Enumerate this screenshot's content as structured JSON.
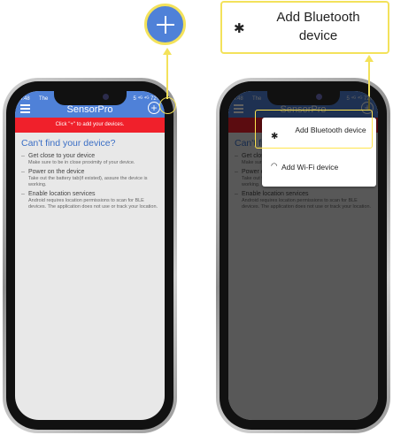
{
  "status": {
    "time": "4:48",
    "carrier": "The",
    "signal": "5 ⁴ᴳ ⁴ᴳ 72%"
  },
  "app": {
    "title": "SensorPro",
    "add_symbol": "+"
  },
  "banner": "Click \"+\" to add your devices.",
  "help": {
    "heading": "Can't find your device?",
    "tips": [
      {
        "title": "Get close to your device",
        "detail": "Make sure to be in close proximity of your device."
      },
      {
        "title": "Power on the device",
        "detail": "Take out the battery tab(if existed), assure the device is working."
      },
      {
        "title": "Enable location services",
        "detail": "Android requires location permissions to scan for BLE devices. The application does not use or track your location."
      }
    ]
  },
  "menu": {
    "items": [
      {
        "label": "Add Bluetooth device",
        "icon": "bluetooth-icon",
        "glyph": "✱"
      },
      {
        "label": "Add Wi-Fi device",
        "icon": "wifi-icon",
        "glyph": "◠"
      }
    ]
  },
  "callout": {
    "label": "Add Bluetooth device",
    "glyph": "✱"
  },
  "colors": {
    "appbar": "#4f81d8",
    "banner": "#f0202b",
    "highlight": "#f3e25b",
    "heading": "#3a6ec5"
  }
}
